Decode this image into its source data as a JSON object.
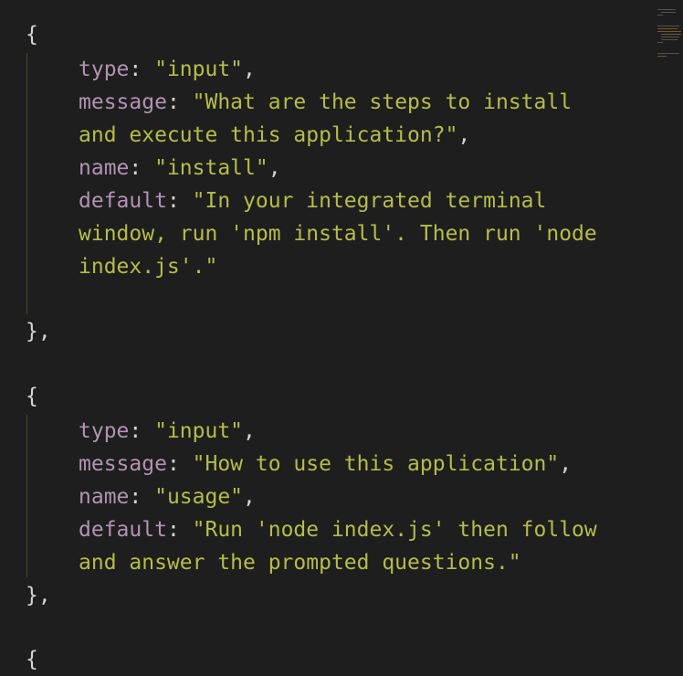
{
  "editor": {
    "blocks": [
      {
        "open": "{",
        "close": "},",
        "lines": [
          {
            "key": "type",
            "sep": ": ",
            "value": "\"input\"",
            "end": ","
          },
          {
            "key": "message",
            "sep": ": ",
            "value": "\"What are the steps to install",
            "end": ""
          },
          {
            "cont": "and execute this application?\"",
            "end": ","
          },
          {
            "key": "name",
            "sep": ": ",
            "value": "\"install\"",
            "end": ","
          },
          {
            "key": "default",
            "sep": ": ",
            "value": "\"In your integrated terminal",
            "end": ""
          },
          {
            "cont": "window, run 'npm install'. Then run 'node",
            "end": ""
          },
          {
            "cont": "index.js'.\"",
            "end": ""
          }
        ]
      },
      {
        "open": "{",
        "close": "},",
        "lines": [
          {
            "key": "type",
            "sep": ": ",
            "value": "\"input\"",
            "end": ","
          },
          {
            "key": "message",
            "sep": ": ",
            "value": "\"How to use this application\"",
            "end": ","
          },
          {
            "key": "name",
            "sep": ": ",
            "value": "\"usage\"",
            "end": ","
          },
          {
            "key": "default",
            "sep": ": ",
            "value": "\"Run 'node index.js' then follow",
            "end": ""
          },
          {
            "cont": "and answer the prompted questions.\"",
            "end": ""
          }
        ]
      }
    ],
    "trailing_brace": "{",
    "colors": {
      "background": "#1e1e1e",
      "key": "#b392b4",
      "string": "#b5bd4a",
      "punctuation": "#d4d4d4"
    }
  }
}
